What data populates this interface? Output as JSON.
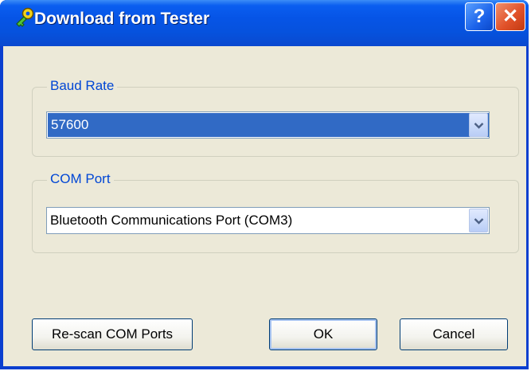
{
  "window": {
    "title": "Download from Tester"
  },
  "titlebar": {
    "help_label": "?",
    "close_label": "✕"
  },
  "baud": {
    "group_label": "Baud Rate",
    "value": "57600"
  },
  "com": {
    "group_label": "COM Port",
    "value": "Bluetooth Communications Port (COM3)"
  },
  "buttons": {
    "rescan_label": "Re-scan COM Ports",
    "ok_label": "OK",
    "cancel_label": "Cancel"
  },
  "icons": {
    "app": "key-icon",
    "dropdown": "chevron-down-icon"
  },
  "colors": {
    "titlebar": "#0654e6",
    "client": "#ece9d8",
    "selection": "#316ac5",
    "group_label": "#0046d5"
  }
}
